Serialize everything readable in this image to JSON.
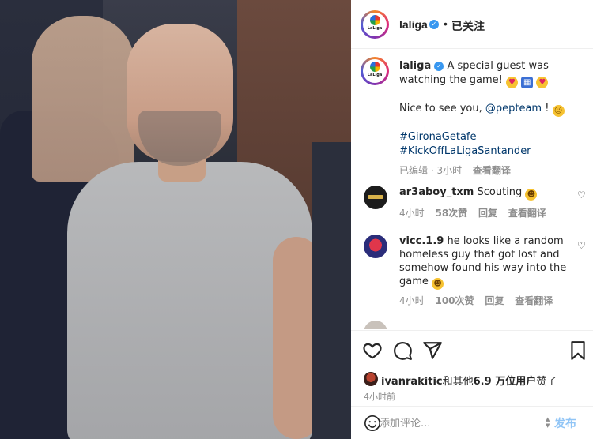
{
  "post": {
    "username": "laliga",
    "follow_label": "已关注",
    "logo_text": "LaLiga",
    "verified_glyph": "✓",
    "separator": "•"
  },
  "caption": {
    "username": "laliga",
    "text_line1": "A special guest was watching the game!",
    "emoji": [
      "heart-eyes",
      "gift",
      "heart-eyes"
    ],
    "text_line2_prefix": "Nice to see you,",
    "mention": "@pepteam",
    "text_line2_suffix": "!",
    "hashtag1": "#GironaGetafe",
    "hashtag2": "#KickOffLaLigaSantander",
    "edited_label": "已编辑 · 3小时",
    "translate_label": "查看翻译"
  },
  "comments": [
    {
      "username": "ar3aboy_txm",
      "text": "Scouting",
      "time": "4小时",
      "likes": "58次赞",
      "reply": "回复",
      "translate": "查看翻译",
      "heart_glyph": "♡"
    },
    {
      "username": "vicc.1.9",
      "text": "he looks like a random homeless guy that got lost and somehow found his way into the game",
      "time": "4小时",
      "likes": "100次赞",
      "reply": "回复",
      "translate": "查看翻译",
      "heart_glyph": "♡"
    }
  ],
  "likes_line": {
    "user": "ivanrakitic",
    "mid": "和其他",
    "count": "6.9 万位用户",
    "tail": "赞了"
  },
  "post_time": "4小时前",
  "composer": {
    "placeholder": "添加评论...",
    "post_label": "发布"
  },
  "icons": [
    "heart-icon",
    "comment-icon",
    "share-icon",
    "bookmark-icon",
    "emoji-icon"
  ]
}
